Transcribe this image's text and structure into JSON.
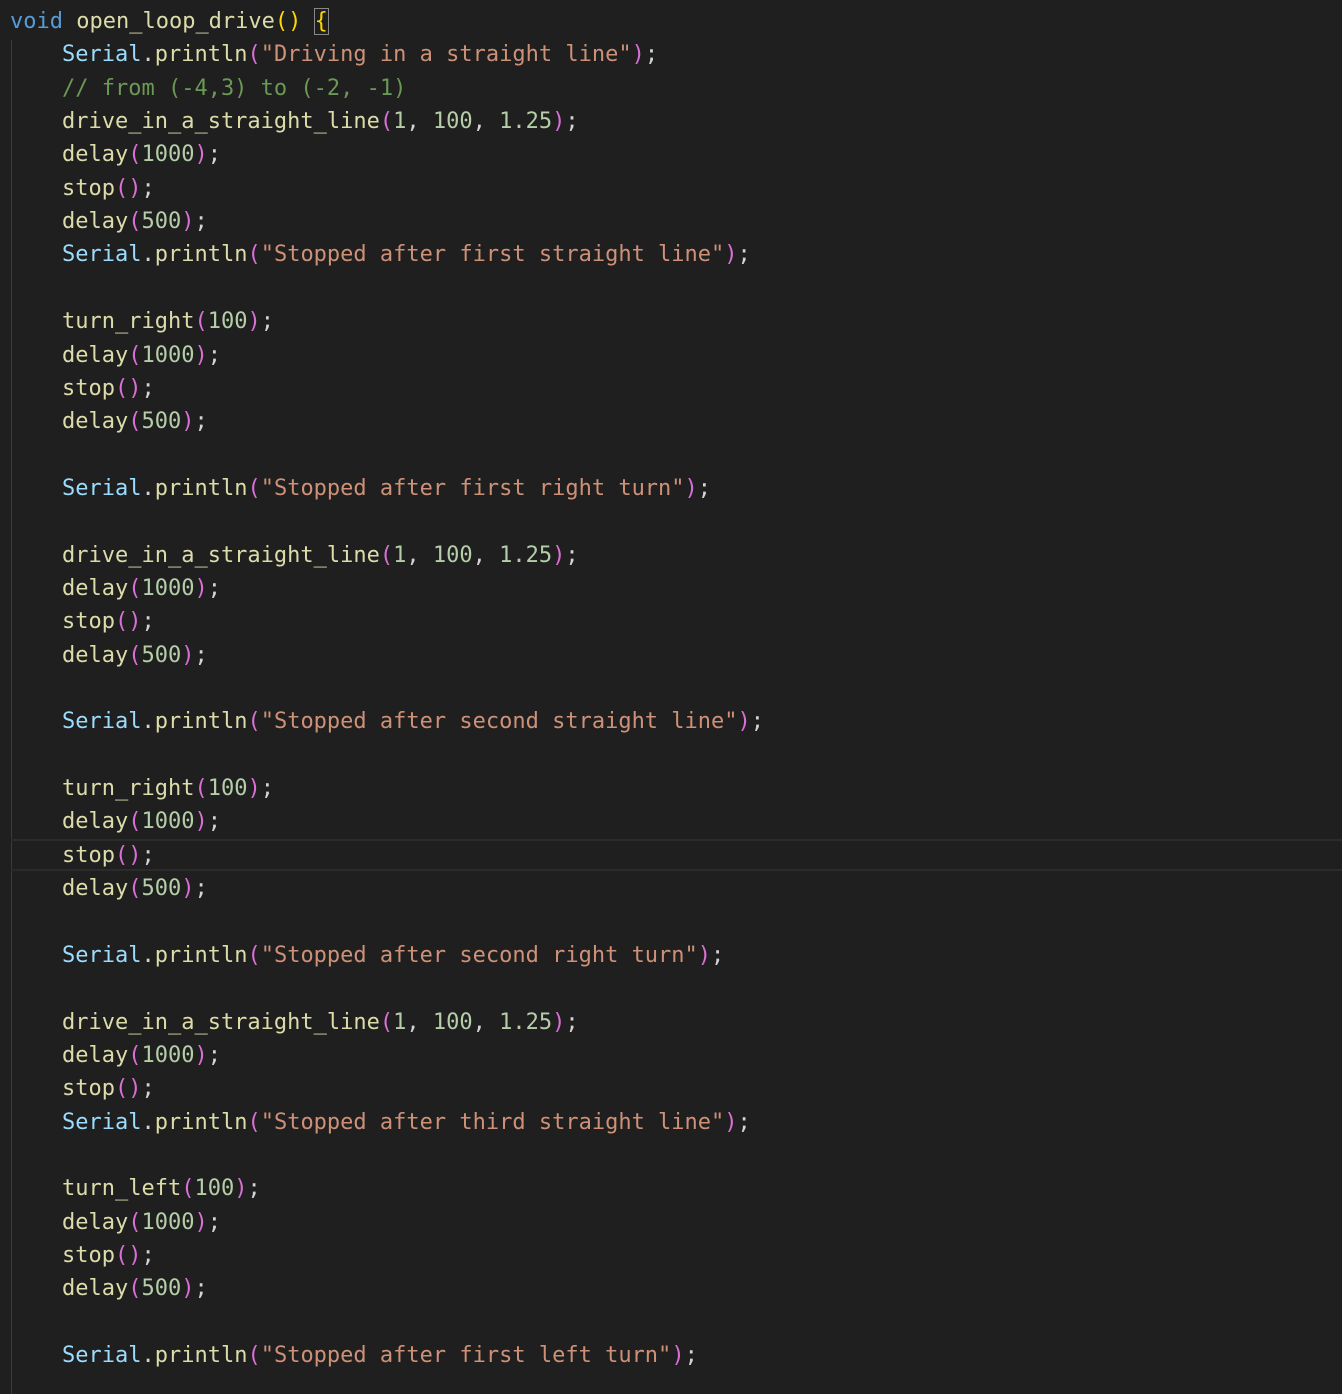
{
  "editor": {
    "colors": {
      "background": "#1f1f1f",
      "keyword": "#569cd6",
      "function": "#dcdcaa",
      "class": "#9cdcfe",
      "string": "#ce9178",
      "number": "#b5cea8",
      "comment": "#6a9955",
      "bracket_level1": "#ffd700",
      "bracket_level2": "#da70d6"
    },
    "highlighted_line": 26,
    "lines": [
      [
        {
          "t": "kw",
          "v": "void"
        },
        {
          "t": "pun",
          "v": " "
        },
        {
          "t": "fn",
          "v": "open_loop_drive"
        },
        {
          "t": "p1",
          "v": "()"
        },
        {
          "t": "pun",
          "v": " "
        },
        {
          "t": "p1 brace-box",
          "v": "{"
        }
      ],
      [
        {
          "t": "cls",
          "v": "Serial"
        },
        {
          "t": "pun",
          "v": "."
        },
        {
          "t": "fn",
          "v": "println"
        },
        {
          "t": "p2",
          "v": "("
        },
        {
          "t": "str",
          "v": "\"Driving in a straight line\""
        },
        {
          "t": "p2",
          "v": ")"
        },
        {
          "t": "pun",
          "v": ";"
        }
      ],
      [
        {
          "t": "cmt",
          "v": "// from (-4,3) to (-2, -1)"
        }
      ],
      [
        {
          "t": "fn",
          "v": "drive_in_a_straight_line"
        },
        {
          "t": "p2",
          "v": "("
        },
        {
          "t": "num",
          "v": "1"
        },
        {
          "t": "pun",
          "v": ", "
        },
        {
          "t": "num",
          "v": "100"
        },
        {
          "t": "pun",
          "v": ", "
        },
        {
          "t": "num",
          "v": "1.25"
        },
        {
          "t": "p2",
          "v": ")"
        },
        {
          "t": "pun",
          "v": ";"
        }
      ],
      [
        {
          "t": "fn",
          "v": "delay"
        },
        {
          "t": "p2",
          "v": "("
        },
        {
          "t": "num",
          "v": "1000"
        },
        {
          "t": "p2",
          "v": ")"
        },
        {
          "t": "pun",
          "v": ";"
        }
      ],
      [
        {
          "t": "fn",
          "v": "stop"
        },
        {
          "t": "p2",
          "v": "()"
        },
        {
          "t": "pun",
          "v": ";"
        }
      ],
      [
        {
          "t": "fn",
          "v": "delay"
        },
        {
          "t": "p2",
          "v": "("
        },
        {
          "t": "num",
          "v": "500"
        },
        {
          "t": "p2",
          "v": ")"
        },
        {
          "t": "pun",
          "v": ";"
        }
      ],
      [
        {
          "t": "cls",
          "v": "Serial"
        },
        {
          "t": "pun",
          "v": "."
        },
        {
          "t": "fn",
          "v": "println"
        },
        {
          "t": "p2",
          "v": "("
        },
        {
          "t": "str",
          "v": "\"Stopped after first straight line\""
        },
        {
          "t": "p2",
          "v": ")"
        },
        {
          "t": "pun",
          "v": ";"
        }
      ],
      [],
      [
        {
          "t": "fn",
          "v": "turn_right"
        },
        {
          "t": "p2",
          "v": "("
        },
        {
          "t": "num",
          "v": "100"
        },
        {
          "t": "p2",
          "v": ")"
        },
        {
          "t": "pun",
          "v": ";"
        }
      ],
      [
        {
          "t": "fn",
          "v": "delay"
        },
        {
          "t": "p2",
          "v": "("
        },
        {
          "t": "num",
          "v": "1000"
        },
        {
          "t": "p2",
          "v": ")"
        },
        {
          "t": "pun",
          "v": ";"
        }
      ],
      [
        {
          "t": "fn",
          "v": "stop"
        },
        {
          "t": "p2",
          "v": "()"
        },
        {
          "t": "pun",
          "v": ";"
        }
      ],
      [
        {
          "t": "fn",
          "v": "delay"
        },
        {
          "t": "p2",
          "v": "("
        },
        {
          "t": "num",
          "v": "500"
        },
        {
          "t": "p2",
          "v": ")"
        },
        {
          "t": "pun",
          "v": ";"
        }
      ],
      [],
      [
        {
          "t": "cls",
          "v": "Serial"
        },
        {
          "t": "pun",
          "v": "."
        },
        {
          "t": "fn",
          "v": "println"
        },
        {
          "t": "p2",
          "v": "("
        },
        {
          "t": "str",
          "v": "\"Stopped after first right turn\""
        },
        {
          "t": "p2",
          "v": ")"
        },
        {
          "t": "pun",
          "v": ";"
        }
      ],
      [],
      [
        {
          "t": "fn",
          "v": "drive_in_a_straight_line"
        },
        {
          "t": "p2",
          "v": "("
        },
        {
          "t": "num",
          "v": "1"
        },
        {
          "t": "pun",
          "v": ", "
        },
        {
          "t": "num",
          "v": "100"
        },
        {
          "t": "pun",
          "v": ", "
        },
        {
          "t": "num",
          "v": "1.25"
        },
        {
          "t": "p2",
          "v": ")"
        },
        {
          "t": "pun",
          "v": ";"
        }
      ],
      [
        {
          "t": "fn",
          "v": "delay"
        },
        {
          "t": "p2",
          "v": "("
        },
        {
          "t": "num",
          "v": "1000"
        },
        {
          "t": "p2",
          "v": ")"
        },
        {
          "t": "pun",
          "v": ";"
        }
      ],
      [
        {
          "t": "fn",
          "v": "stop"
        },
        {
          "t": "p2",
          "v": "()"
        },
        {
          "t": "pun",
          "v": ";"
        }
      ],
      [
        {
          "t": "fn",
          "v": "delay"
        },
        {
          "t": "p2",
          "v": "("
        },
        {
          "t": "num",
          "v": "500"
        },
        {
          "t": "p2",
          "v": ")"
        },
        {
          "t": "pun",
          "v": ";"
        }
      ],
      [],
      [
        {
          "t": "cls",
          "v": "Serial"
        },
        {
          "t": "pun",
          "v": "."
        },
        {
          "t": "fn",
          "v": "println"
        },
        {
          "t": "p2",
          "v": "("
        },
        {
          "t": "str",
          "v": "\"Stopped after second straight line\""
        },
        {
          "t": "p2",
          "v": ")"
        },
        {
          "t": "pun",
          "v": ";"
        }
      ],
      [],
      [
        {
          "t": "fn",
          "v": "turn_right"
        },
        {
          "t": "p2",
          "v": "("
        },
        {
          "t": "num",
          "v": "100"
        },
        {
          "t": "p2",
          "v": ")"
        },
        {
          "t": "pun",
          "v": ";"
        }
      ],
      [
        {
          "t": "fn",
          "v": "delay"
        },
        {
          "t": "p2",
          "v": "("
        },
        {
          "t": "num",
          "v": "1000"
        },
        {
          "t": "p2",
          "v": ")"
        },
        {
          "t": "pun",
          "v": ";"
        }
      ],
      [
        {
          "t": "fn",
          "v": "stop"
        },
        {
          "t": "p2",
          "v": "()"
        },
        {
          "t": "pun",
          "v": ";"
        }
      ],
      [
        {
          "t": "fn",
          "v": "delay"
        },
        {
          "t": "p2",
          "v": "("
        },
        {
          "t": "num",
          "v": "500"
        },
        {
          "t": "p2",
          "v": ")"
        },
        {
          "t": "pun",
          "v": ";"
        }
      ],
      [],
      [
        {
          "t": "cls",
          "v": "Serial"
        },
        {
          "t": "pun",
          "v": "."
        },
        {
          "t": "fn",
          "v": "println"
        },
        {
          "t": "p2",
          "v": "("
        },
        {
          "t": "str",
          "v": "\"Stopped after second right turn\""
        },
        {
          "t": "p2",
          "v": ")"
        },
        {
          "t": "pun",
          "v": ";"
        }
      ],
      [],
      [
        {
          "t": "fn",
          "v": "drive_in_a_straight_line"
        },
        {
          "t": "p2",
          "v": "("
        },
        {
          "t": "num",
          "v": "1"
        },
        {
          "t": "pun",
          "v": ", "
        },
        {
          "t": "num",
          "v": "100"
        },
        {
          "t": "pun",
          "v": ", "
        },
        {
          "t": "num",
          "v": "1.25"
        },
        {
          "t": "p2",
          "v": ")"
        },
        {
          "t": "pun",
          "v": ";"
        }
      ],
      [
        {
          "t": "fn",
          "v": "delay"
        },
        {
          "t": "p2",
          "v": "("
        },
        {
          "t": "num",
          "v": "1000"
        },
        {
          "t": "p2",
          "v": ")"
        },
        {
          "t": "pun",
          "v": ";"
        }
      ],
      [
        {
          "t": "fn",
          "v": "stop"
        },
        {
          "t": "p2",
          "v": "()"
        },
        {
          "t": "pun",
          "v": ";"
        }
      ],
      [
        {
          "t": "cls",
          "v": "Serial"
        },
        {
          "t": "pun",
          "v": "."
        },
        {
          "t": "fn",
          "v": "println"
        },
        {
          "t": "p2",
          "v": "("
        },
        {
          "t": "str",
          "v": "\"Stopped after third straight line\""
        },
        {
          "t": "p2",
          "v": ")"
        },
        {
          "t": "pun",
          "v": ";"
        }
      ],
      [],
      [
        {
          "t": "fn",
          "v": "turn_left"
        },
        {
          "t": "p2",
          "v": "("
        },
        {
          "t": "num",
          "v": "100"
        },
        {
          "t": "p2",
          "v": ")"
        },
        {
          "t": "pun",
          "v": ";"
        }
      ],
      [
        {
          "t": "fn",
          "v": "delay"
        },
        {
          "t": "p2",
          "v": "("
        },
        {
          "t": "num",
          "v": "1000"
        },
        {
          "t": "p2",
          "v": ")"
        },
        {
          "t": "pun",
          "v": ";"
        }
      ],
      [
        {
          "t": "fn",
          "v": "stop"
        },
        {
          "t": "p2",
          "v": "()"
        },
        {
          "t": "pun",
          "v": ";"
        }
      ],
      [
        {
          "t": "fn",
          "v": "delay"
        },
        {
          "t": "p2",
          "v": "("
        },
        {
          "t": "num",
          "v": "500"
        },
        {
          "t": "p2",
          "v": ")"
        },
        {
          "t": "pun",
          "v": ";"
        }
      ],
      [],
      [
        {
          "t": "cls",
          "v": "Serial"
        },
        {
          "t": "pun",
          "v": "."
        },
        {
          "t": "fn",
          "v": "println"
        },
        {
          "t": "p2",
          "v": "("
        },
        {
          "t": "str",
          "v": "\"Stopped after first left turn\""
        },
        {
          "t": "p2",
          "v": ")"
        },
        {
          "t": "pun",
          "v": ";"
        }
      ]
    ]
  }
}
